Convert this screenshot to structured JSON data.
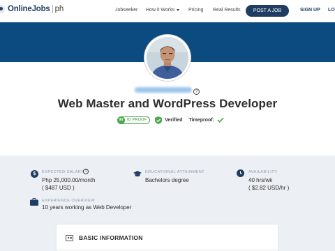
{
  "nav": {
    "logo_main": "OnlineJobs",
    "logo_suffix": "ph",
    "links": [
      "Jobseeker",
      "How it Works",
      "Pricing",
      "Real Results"
    ],
    "post_job": "POST A JOB",
    "signup": "SIGN UP",
    "login": "LO"
  },
  "profile": {
    "title": "Web Master and WordPress Developer",
    "id_proof_score": "90",
    "id_proof_label": "ID PROOF",
    "verified": "Verified",
    "timeproof": "Timeproof:",
    "help_glyph": "?"
  },
  "stats": {
    "salary": {
      "label": "EXPECTED SALARY",
      "value1": "Php 25,000.00/month",
      "value2": "( $487 USD )",
      "icon": "dollar-icon"
    },
    "education": {
      "label": "EDUCATIONAL ATTAINMENT",
      "value1": "Bachelors degree",
      "icon": "graduation-cap-icon"
    },
    "availability": {
      "label": "AVAILABILITY",
      "value1": "40 hrs/wk",
      "value2": "( $2.82 USD/hr )",
      "icon": "clock-icon"
    },
    "experience": {
      "label": "EXPERIENCE OVERVIEW",
      "value1": "10 years working as Web Developer",
      "icon": "briefcase-icon"
    }
  },
  "card": {
    "title": "BASIC INFORMATION"
  },
  "colors": {
    "brand": "#1f3d63",
    "banner": "#0b4b80",
    "success": "#49a84e",
    "info_bg": "#eceff3"
  }
}
